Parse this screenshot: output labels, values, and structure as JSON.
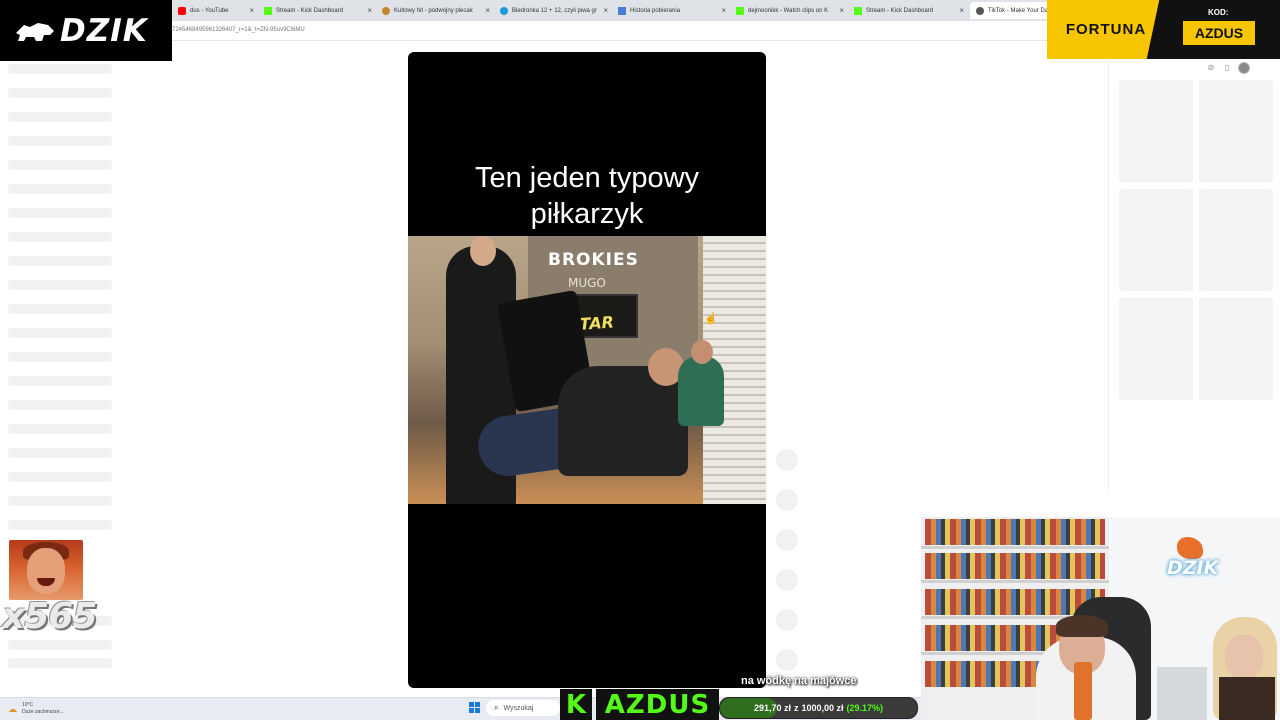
{
  "browser": {
    "tabs": [
      {
        "label": "dus - YouTube",
        "color": "#ff0000"
      },
      {
        "label": "Stream - Kick Dashboard",
        "color": "#53fc18"
      },
      {
        "label": "Kultowy hit - podwójny plecak",
        "color": "#c4862a"
      },
      {
        "label": "Biedronka 12 + 12, czyli piwa gr",
        "color": "#1a9ad8"
      },
      {
        "label": "Historia pobierania",
        "color": "#4a7bd8"
      },
      {
        "label": "dejmoonikk - Watch clips on K",
        "color": "#53fc18"
      },
      {
        "label": "Stream - Kick Dashboard",
        "color": "#53fc18"
      },
      {
        "label": "TikTok - Make Your Da",
        "color": "#555555"
      }
    ],
    "url": "7245468495961326407_r=1&_t=ZN-95uv9C6iMU"
  },
  "overlay": {
    "logo_text": "DZIK",
    "sponsor_brand": "FORTUNA",
    "code_label": "KOD:",
    "code_value": "AZDUS",
    "emote_count": "x565",
    "kick_letter": "K",
    "channel_tag": "AZDUS",
    "goal": {
      "current": "291,70 zł",
      "separator": "z",
      "target": "1000,00 zł",
      "percent_label": "(29.17%)",
      "progress": 0.2917
    },
    "subtitle": "na wódkę na majówce",
    "cam_logo": "DZIK"
  },
  "video": {
    "caption_line1": "Ten jeden typowy",
    "caption_line2": "piłkarzyk",
    "scene_sign1": "BROKIES",
    "scene_sign2": "MUGO",
    "scene_sign3": "STAR"
  },
  "taskbar": {
    "weather_temp": "10°C",
    "weather_desc": "Duże zachmurze...",
    "search_label": "Wyszukaj"
  },
  "colors": {
    "kick_green": "#53fc18",
    "fortuna_yellow": "#f7c600"
  },
  "icons": {
    "weather": "cloud-sun-icon",
    "search": "search-icon",
    "windows": "windows-start-icon"
  }
}
